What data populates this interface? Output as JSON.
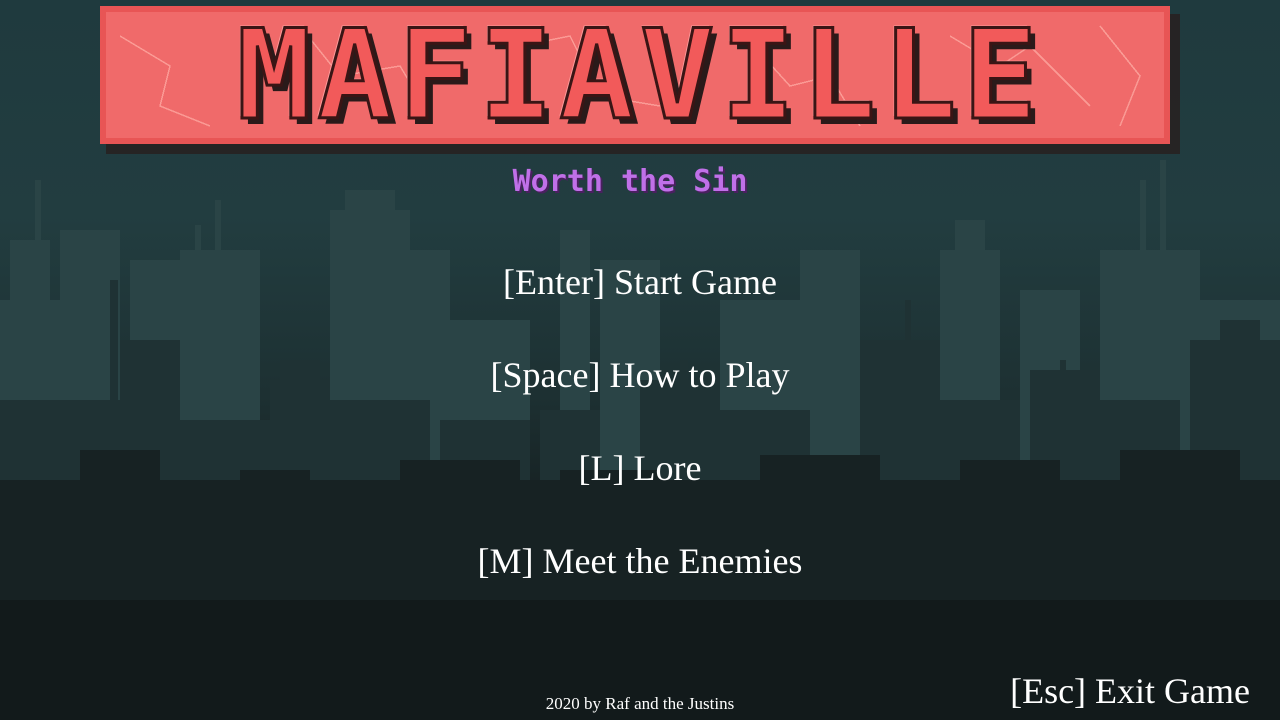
{
  "logo": {
    "title": "MAFIAVILLE",
    "subtitle": "Worth the Sin"
  },
  "menu": {
    "start": "[Enter] Start Game",
    "how_to_play": "[Space] How to Play",
    "lore": "[L] Lore",
    "enemies": "[M] Meet the Enemies",
    "exit": "[Esc] Exit Game"
  },
  "footer": {
    "credits": "2020 by Raf and the Justins"
  },
  "colors": {
    "logo_red": "#f25a5a",
    "subtitle_purple": "#c070e8",
    "sky_top": "#1f3a3e",
    "ground": "#101617"
  }
}
